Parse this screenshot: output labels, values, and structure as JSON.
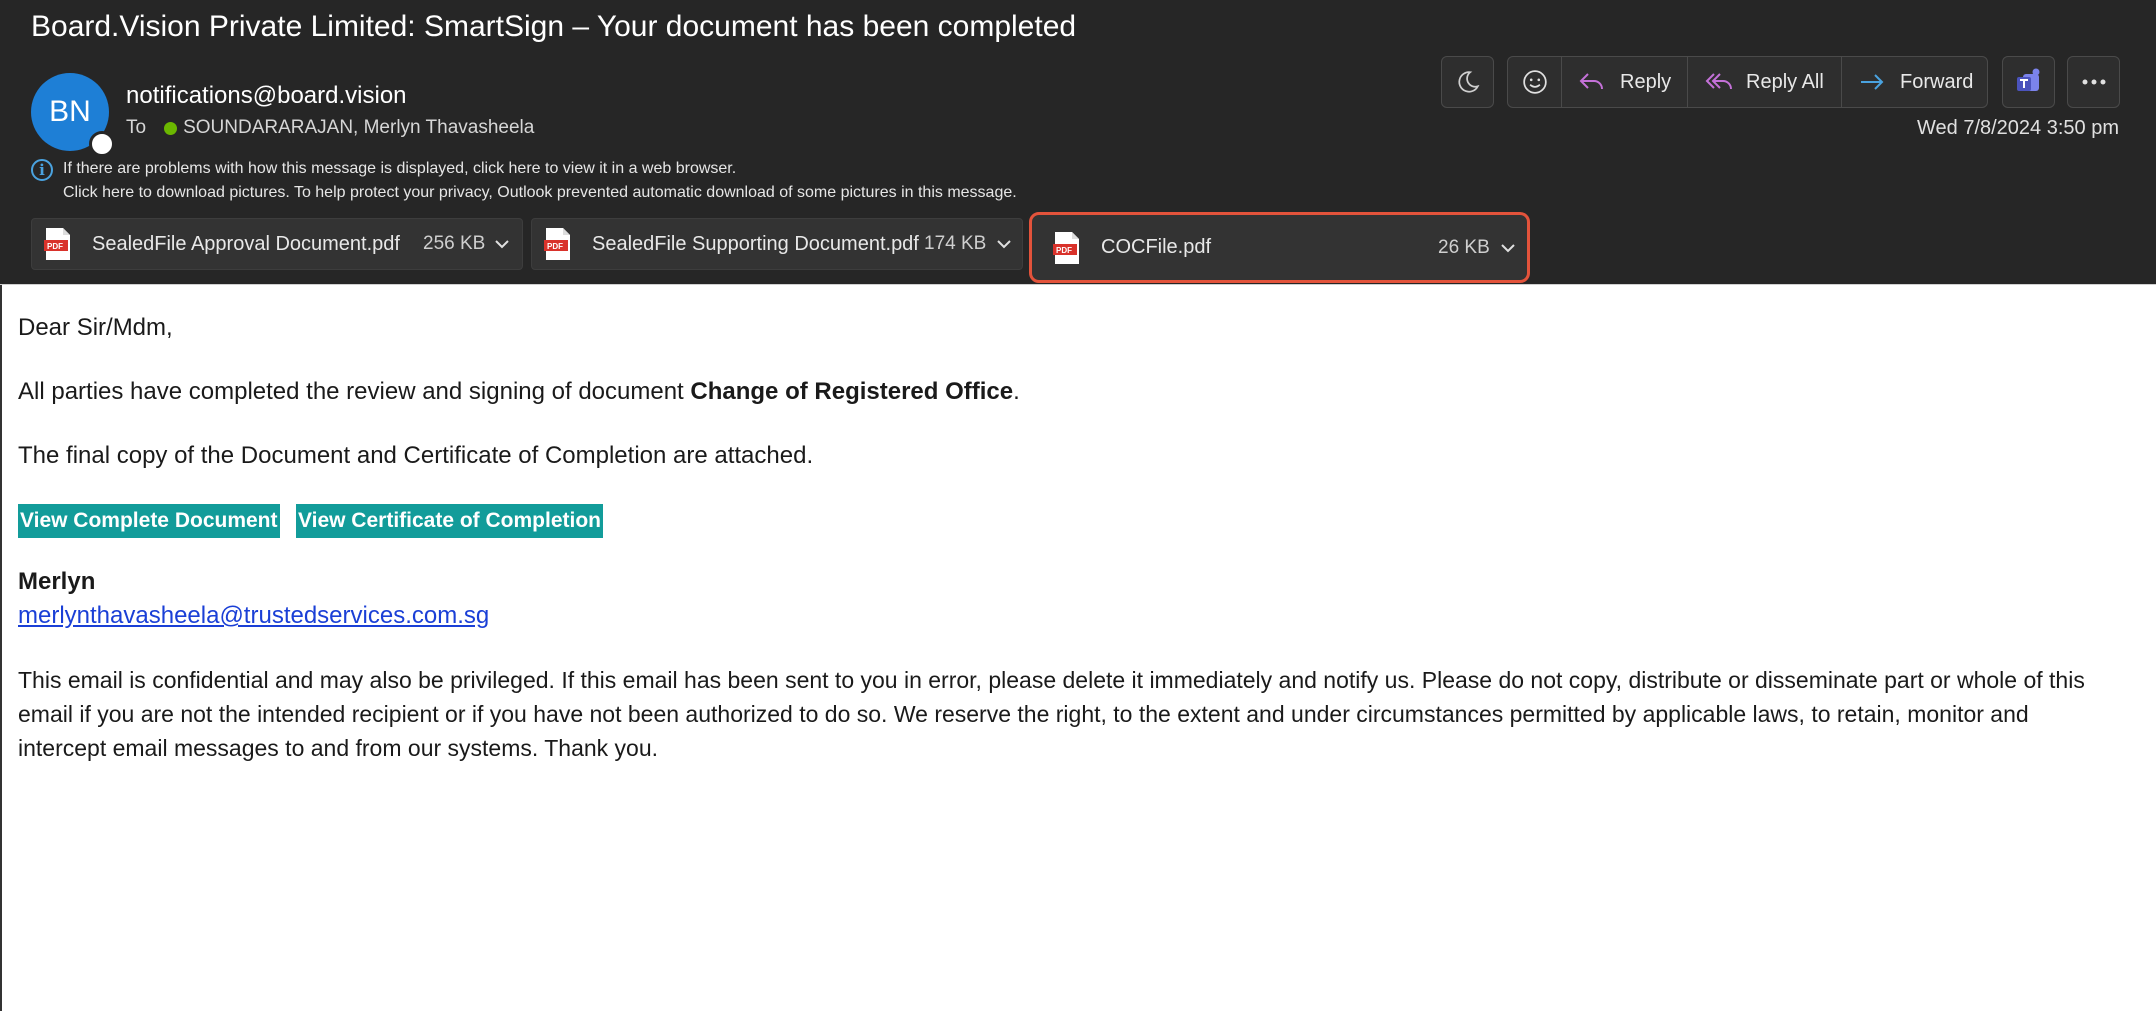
{
  "email": {
    "subject": "Board.Vision Private Limited: SmartSign – Your document has been completed",
    "sender": {
      "initials": "BN",
      "address": "notifications@board.vision"
    },
    "to_label": "To",
    "recipient": "SOUNDARARAJAN, Merlyn Thavasheela",
    "date": "Wed 7/8/2024 3:50 pm",
    "info_lines": [
      "If there are problems with how this message is displayed, click here to view it in a web browser.",
      "Click here to download pictures. To help protect your privacy, Outlook prevented automatic download of some pictures in this message."
    ]
  },
  "toolbar": {
    "reply_label": "Reply",
    "reply_all_label": "Reply All",
    "forward_label": "Forward",
    "icons": [
      "moon-icon",
      "emoji-icon",
      "reply-icon",
      "reply-all-icon",
      "forward-icon",
      "teams-icon",
      "more-icon"
    ]
  },
  "attachments": [
    {
      "name": "SealedFile Approval Document.pdf",
      "size": "256 KB",
      "icon": "pdf-icon",
      "selected": false
    },
    {
      "name": "SealedFile Supporting Document.pdf",
      "size": "174 KB",
      "icon": "pdf-icon",
      "selected": false
    },
    {
      "name": "COCFile.pdf",
      "size": "26 KB",
      "icon": "pdf-icon",
      "selected": true
    }
  ],
  "body": {
    "greeting": "Dear Sir/Mdm,",
    "line1_prefix": "All parties have completed the review and signing of document ",
    "document_name": "Change of Registered Office",
    "line1_suffix": ".",
    "line2": "The final copy of the Document and Certificate of Completion are attached.",
    "buttons": [
      "View Complete Document",
      "View Certificate of Completion"
    ],
    "signature_name": "Merlyn",
    "signature_email": "merlynthavasheela@trustedservices.com.sg",
    "disclaimer": "This email is confidential and may also be privileged. If this email has been sent to you in error, please delete it immediately and notify us. Please do not copy, distribute or disseminate part or whole of this email if you are not the intended recipient or if you have not been authorized to do so. We reserve the right, to the extent and under circumstances permitted by applicable laws, to retain, monitor and intercept email messages to and from our systems. Thank you."
  },
  "colors": {
    "header_bg": "#262626",
    "avatar": "#1e7fd6",
    "selected_outline": "#e3533b",
    "button_teal": "#129c9a",
    "link": "#1a3fd6",
    "presence_green": "#6bb700",
    "reply_icon": "#c471d8",
    "forward_icon": "#4aa3e0",
    "teams_icon": "#5b5fc7"
  }
}
